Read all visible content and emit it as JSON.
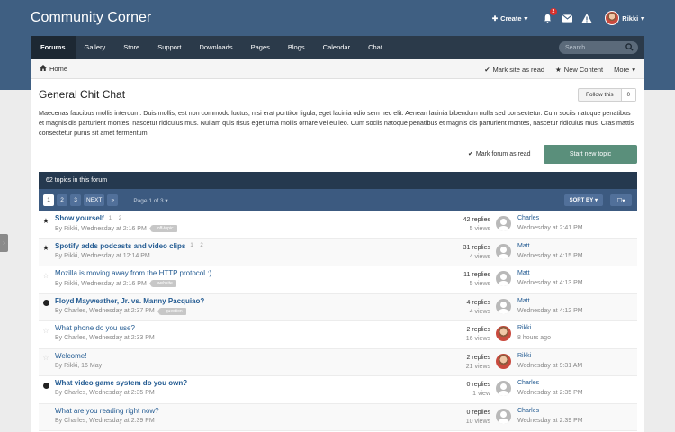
{
  "header": {
    "site_title": "Community Corner",
    "create_label": "Create",
    "notification_count": "2",
    "user_name": "Rikki"
  },
  "nav": {
    "items": [
      "Forums",
      "Gallery",
      "Store",
      "Support",
      "Downloads",
      "Pages",
      "Blogs",
      "Calendar",
      "Chat"
    ],
    "active": "Forums",
    "search_placeholder": "Search..."
  },
  "breadcrumb": {
    "home": "Home",
    "mark_site_read": "Mark site as read",
    "new_content": "New Content",
    "more": "More"
  },
  "forum": {
    "title": "General Chit Chat",
    "follow_label": "Follow this",
    "follow_count": "0",
    "description": "Maecenas faucibus mollis interdum. Duis mollis, est non commodo luctus, nisi erat porttitor ligula, eget lacinia odio sem nec elit. Aenean lacinia bibendum nulla sed consectetur. Cum sociis natoque penatibus et magnis dis parturient montes, nascetur ridiculus mus. Nullam quis risus eget urna mollis ornare vel eu leo. Cum sociis natoque penatibus et magnis dis parturient montes, nascetur ridiculus mus. Cras mattis consectetur purus sit amet fermentum.",
    "mark_forum_read": "Mark forum as read",
    "start_topic": "Start new topic",
    "topic_count": "62 topics in this forum"
  },
  "pager": {
    "pages": [
      "1",
      "2",
      "3"
    ],
    "next": "NEXT",
    "last": "»",
    "page_of": "Page 1 of 3",
    "sort_by": "SORT BY"
  },
  "topics": [
    {
      "icon": "star",
      "title": "Show yourself",
      "bold": true,
      "mini_pages": "1  2",
      "meta": "By Rikki, Wednesday at 2:16 PM",
      "tag": "off-topic",
      "replies": "42 replies",
      "views": "5 views",
      "last_user": "Charles",
      "last_time": "Wednesday at 2:41 PM",
      "photo": false
    },
    {
      "icon": "star",
      "title": "Spotify adds podcasts and video clips",
      "bold": true,
      "mini_pages": "1  2",
      "meta": "By Rikki, Wednesday at 12:14 PM",
      "tag": "",
      "replies": "31 replies",
      "views": "4 views",
      "last_user": "Matt",
      "last_time": "Wednesday at 4:15 PM",
      "photo": false
    },
    {
      "icon": "star-outline",
      "title": "Mozilla is moving away from the HTTP protocol :)",
      "bold": false,
      "mini_pages": "",
      "meta": "By Rikki, Wednesday at 2:16 PM",
      "tag": "website",
      "replies": "11 replies",
      "views": "5 views",
      "last_user": "Matt",
      "last_time": "Wednesday at 4:13 PM",
      "photo": false
    },
    {
      "icon": "dot",
      "title": "Floyd Mayweather, Jr. vs. Manny Pacquiao?",
      "bold": true,
      "mini_pages": "",
      "meta": "By Charles, Wednesday at 2:37 PM",
      "tag": "question",
      "replies": "4 replies",
      "views": "4 views",
      "last_user": "Matt",
      "last_time": "Wednesday at 4:12 PM",
      "photo": false
    },
    {
      "icon": "star-outline",
      "title": "What phone do you use?",
      "bold": false,
      "mini_pages": "",
      "meta": "By Charles, Wednesday at 2:33 PM",
      "tag": "",
      "replies": "2 replies",
      "views": "16 views",
      "last_user": "Rikki",
      "last_time": "8 hours ago",
      "photo": true
    },
    {
      "icon": "star-outline",
      "title": "Welcome!",
      "bold": false,
      "mini_pages": "",
      "meta": "By Rikki, 16 May",
      "tag": "",
      "replies": "2 replies",
      "views": "21 views",
      "last_user": "Rikki",
      "last_time": "Wednesday at 9:31 AM",
      "photo": true
    },
    {
      "icon": "dot",
      "title": "What video game system do you own?",
      "bold": true,
      "mini_pages": "",
      "meta": "By Charles, Wednesday at 2:35 PM",
      "tag": "",
      "replies": "0 replies",
      "views": "1 view",
      "last_user": "Charles",
      "last_time": "Wednesday at 2:35 PM",
      "photo": false
    },
    {
      "icon": "none",
      "title": "What are you reading right now?",
      "bold": false,
      "mini_pages": "",
      "meta": "By Charles, Wednesday at 2:39 PM",
      "tag": "",
      "replies": "0 replies",
      "views": "10 views",
      "last_user": "Charles",
      "last_time": "Wednesday at 2:39 PM",
      "photo": false
    }
  ],
  "colors": {
    "header_bg": "#3f5f82",
    "nav_bg": "#2b3a4a",
    "link": "#235b92",
    "start_button": "#5a8f7b"
  }
}
